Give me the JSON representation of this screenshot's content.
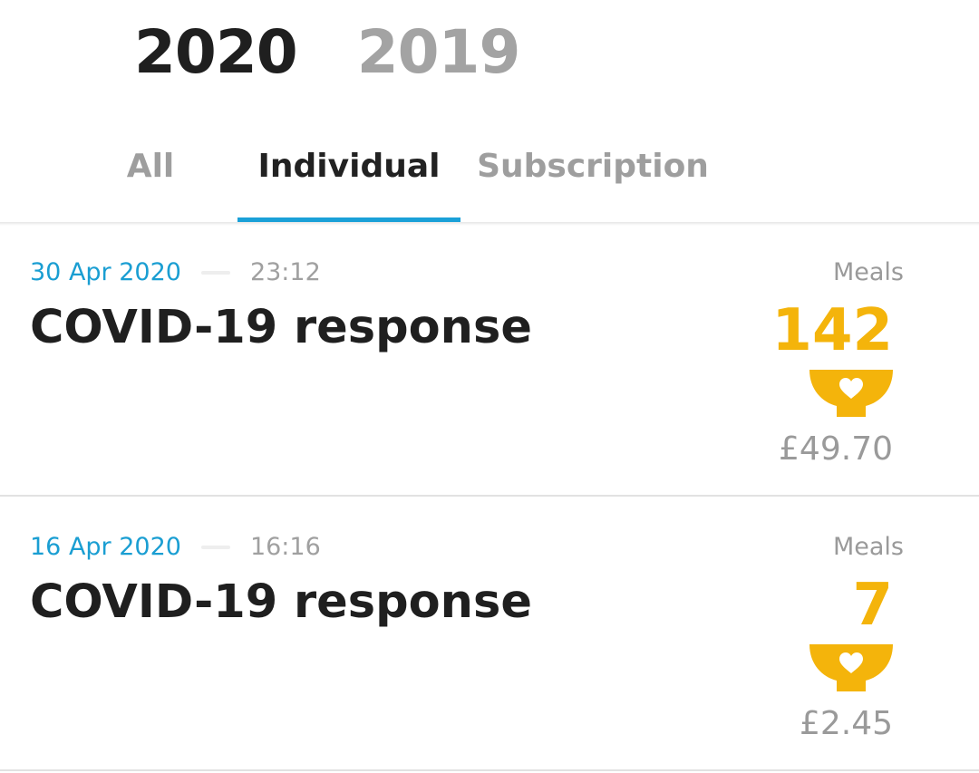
{
  "years": {
    "active": "2020",
    "inactive": "2019"
  },
  "tabs": {
    "all": "All",
    "individual": "Individual",
    "subscription": "Subscription",
    "selected": "Individual"
  },
  "donations": [
    {
      "date": "30 Apr 2020",
      "time": "23:12",
      "title": "COVID-19 response",
      "meals_label": "Meals",
      "meals_count": "142",
      "amount": "£49.70"
    },
    {
      "date": "16 Apr 2020",
      "time": "16:16",
      "title": "COVID-19 response",
      "meals_label": "Meals",
      "meals_count": "7",
      "amount": "£2.45"
    }
  ],
  "icons": {
    "meal": "bowl-heart-icon"
  },
  "colors": {
    "accent_blue": "#1a9ed2",
    "meal_yellow": "#f4b40b",
    "text_dark": "#1f1f1f",
    "text_muted": "#9e9e9e"
  }
}
